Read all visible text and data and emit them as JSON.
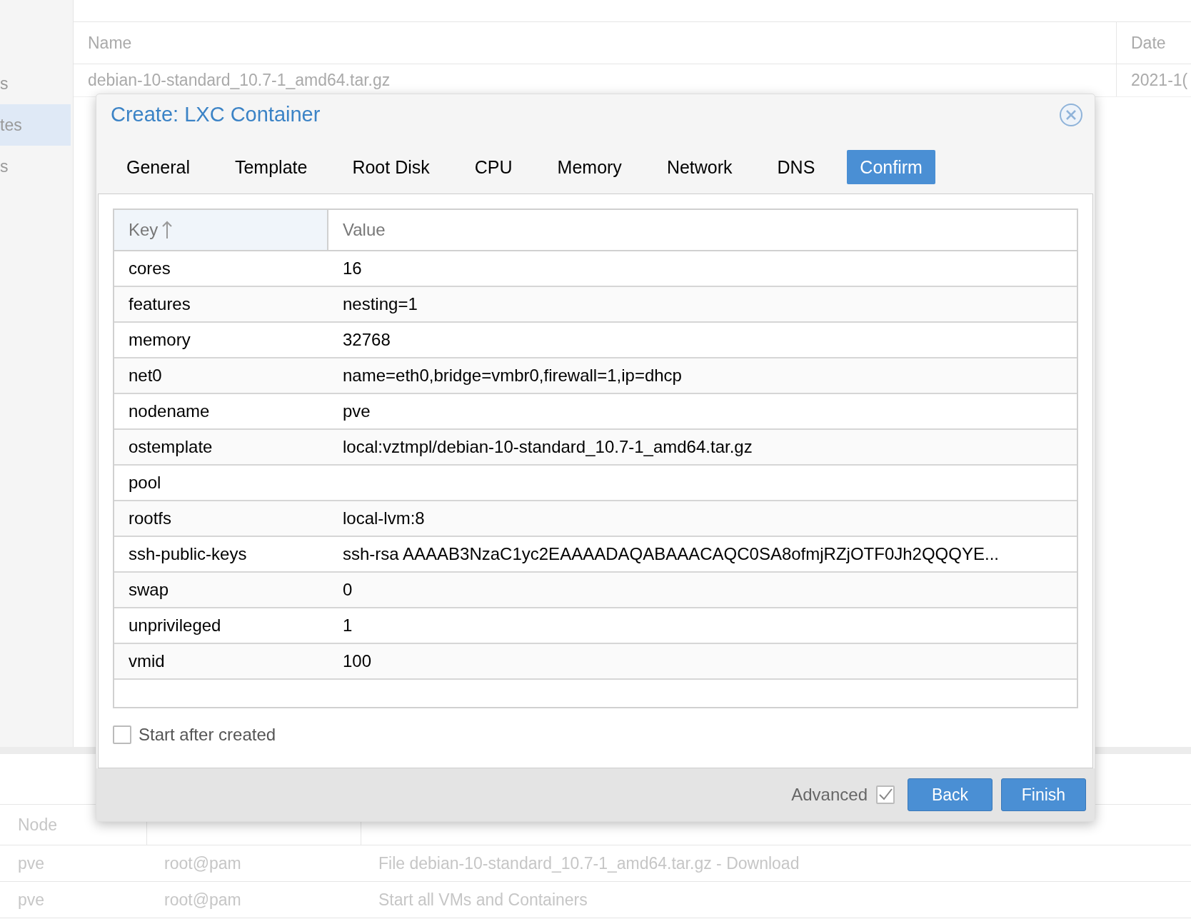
{
  "background": {
    "sidebar_items": [
      {
        "label": "s",
        "selected": false
      },
      {
        "label": "tes",
        "selected": true
      },
      {
        "label": "s",
        "selected": false
      }
    ],
    "grid": {
      "columns": [
        "Name",
        "Date"
      ],
      "rows": [
        [
          "debian-10-standard_10.7-1_amd64.tar.gz",
          "2021-1("
        ]
      ]
    },
    "tasks": {
      "columns": [
        "Node"
      ],
      "rows": [
        [
          "pve",
          "root@pam",
          "File debian-10-standard_10.7-1_amd64.tar.gz - Download"
        ],
        [
          "pve",
          "root@pam",
          "Start all VMs and Containers"
        ]
      ]
    }
  },
  "dialog": {
    "title": "Create: LXC Container",
    "tabs": [
      {
        "label": "General",
        "selected": false
      },
      {
        "label": "Template",
        "selected": false
      },
      {
        "label": "Root Disk",
        "selected": false
      },
      {
        "label": "CPU",
        "selected": false
      },
      {
        "label": "Memory",
        "selected": false
      },
      {
        "label": "Network",
        "selected": false
      },
      {
        "label": "DNS",
        "selected": false
      },
      {
        "label": "Confirm",
        "selected": true
      }
    ],
    "table": {
      "columns": [
        "Key",
        "Value"
      ],
      "rows": [
        {
          "key": "cores",
          "value": "16"
        },
        {
          "key": "features",
          "value": "nesting=1"
        },
        {
          "key": "memory",
          "value": "32768"
        },
        {
          "key": "net0",
          "value": "name=eth0,bridge=vmbr0,firewall=1,ip=dhcp"
        },
        {
          "key": "nodename",
          "value": "pve"
        },
        {
          "key": "ostemplate",
          "value": "local:vztmpl/debian-10-standard_10.7-1_amd64.tar.gz"
        },
        {
          "key": "pool"
        },
        {
          "key": "rootfs",
          "value": "local-lvm:8"
        },
        {
          "key": "ssh-public-keys",
          "value": "ssh-rsa AAAAB3NzaC1yc2EAAAADAQABAAACAQC0SA8ofmjRZjOTF0Jh2QQQYE..."
        },
        {
          "key": "swap",
          "value": "0"
        },
        {
          "key": "unprivileged",
          "value": "1"
        },
        {
          "key": "vmid",
          "value": "100"
        }
      ]
    },
    "start_after_created": {
      "label": "Start after created",
      "checked": false
    },
    "advanced": {
      "label": "Advanced",
      "checked": true
    },
    "buttons": [
      "Back",
      "Finish"
    ]
  }
}
